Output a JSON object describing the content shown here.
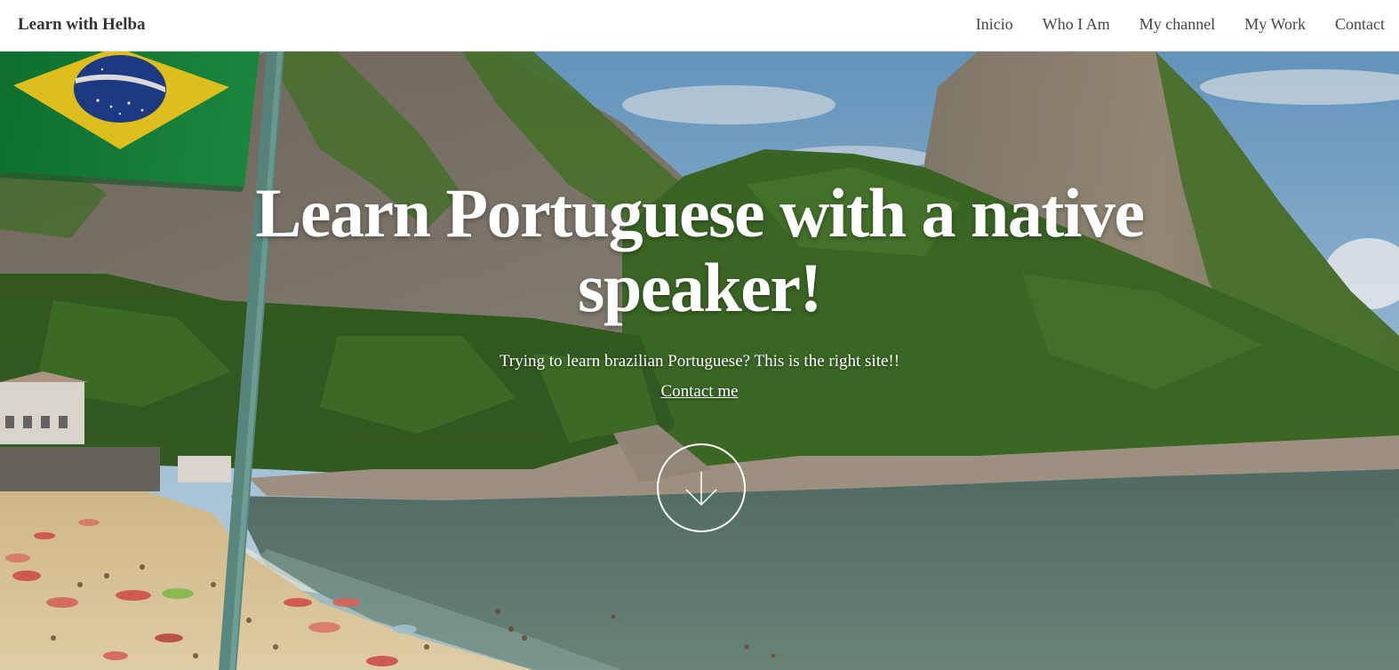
{
  "brand": {
    "name": "Learn with Helba"
  },
  "nav": {
    "items": [
      {
        "label": "Inicio"
      },
      {
        "label": "Who I Am"
      },
      {
        "label": "My channel"
      },
      {
        "label": "My Work"
      },
      {
        "label": "Contact"
      }
    ]
  },
  "hero": {
    "title": "Learn Portuguese with a native speaker!",
    "subtitle": "Trying to learn brazilian Portuguese? This is the right site!!",
    "cta_label": "Contact me",
    "scroll_icon": "arrow-down-icon"
  },
  "colors": {
    "hero_text": "#ffffff",
    "nav_text": "#444444",
    "brand_text": "#333333",
    "sky": "#8cb8da",
    "sea": "#5f7a6e",
    "sand": "#e6cf9f",
    "forest": "#3f6b2a",
    "rock": "#7e7668",
    "flag_green": "#1f8a3c",
    "flag_yellow": "#f4d21f",
    "flag_blue": "#1f3f8f"
  }
}
